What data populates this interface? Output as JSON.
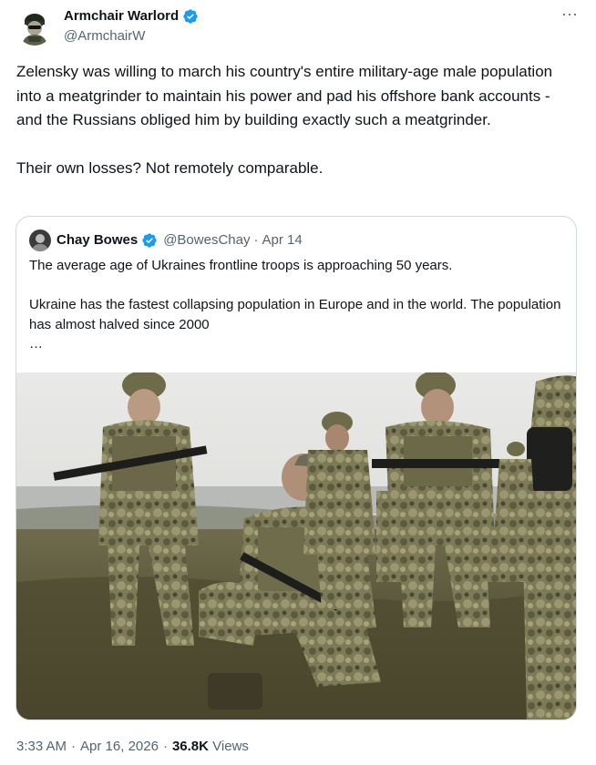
{
  "tweet": {
    "author_name": "Armchair Warlord",
    "author_handle": "@ArmchairW",
    "more_icon": "more-horizontal-icon",
    "more_glyph": "···",
    "paragraphs": [
      "Zelensky was willing to march his country's entire military-age male population into a meatgrinder to maintain his power and pad his offshore bank accounts - and the Russians obliged him by building exactly such a meatgrinder.",
      "Their own losses?  Not remotely comparable."
    ],
    "time": "3:33 AM",
    "date": "Apr 16, 2026",
    "separator": "·",
    "views_count": "36.8K",
    "views_label": "Views"
  },
  "quote": {
    "author_name": "Chay Bowes",
    "author_handle": "@BowesChay",
    "separator": "·",
    "date": "Apr 14",
    "paragraphs": [
      "The average age of Ukraines frontline troops is approaching 50 years.",
      "Ukraine has the fastest collapsing population in Europe and in the world. The population has almost halved since 2000"
    ],
    "ellipsis": "…",
    "photo_icon": "photo-soldiers-field"
  },
  "colors": {
    "text": "#0f1419",
    "secondary": "#536471",
    "verified": "#1d9bf0",
    "border": "#cfd9de"
  }
}
